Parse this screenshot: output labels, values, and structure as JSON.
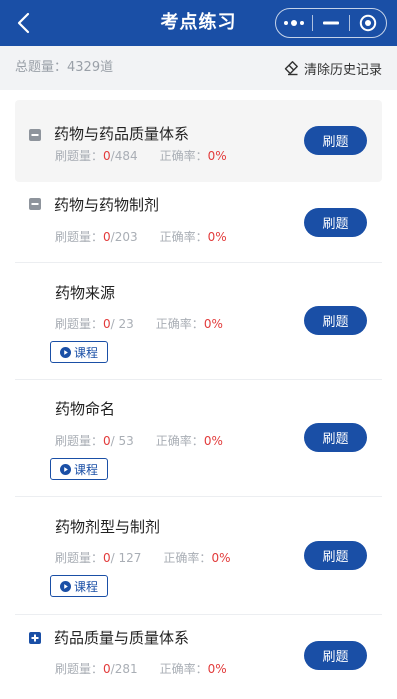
{
  "header": {
    "title": "考点练习"
  },
  "summary": {
    "total_label": "总题量：4329道",
    "clear_label": "清除历史记录"
  },
  "labels": {
    "done": "刷题量：",
    "accuracy": "正确率：",
    "practice": "刷题",
    "course": "课程"
  },
  "items": [
    {
      "name": "药物与药品质量体系",
      "done": "0",
      "total": "/484",
      "accuracy": "0%",
      "toggle": "minus",
      "has_course": false
    },
    {
      "name": "药物与药物制剂",
      "done": "0",
      "total": "/203",
      "accuracy": "0%",
      "toggle": "minus",
      "has_course": false
    },
    {
      "name": "药物来源",
      "done": "0",
      "total": "/ 23",
      "accuracy": "0%",
      "toggle": "none",
      "has_course": true
    },
    {
      "name": "药物命名",
      "done": "0",
      "total": "/ 53",
      "accuracy": "0%",
      "toggle": "none",
      "has_course": true
    },
    {
      "name": "药物剂型与制剂",
      "done": "0",
      "total": "/ 127",
      "accuracy": "0%",
      "toggle": "none",
      "has_course": true
    },
    {
      "name": "药品质量与质量体系",
      "done": "0",
      "total": "/281",
      "accuracy": "0%",
      "toggle": "plus",
      "has_course": false
    }
  ],
  "colors": {
    "primary": "#1a4fa6",
    "accent_red": "#e23b3b"
  }
}
